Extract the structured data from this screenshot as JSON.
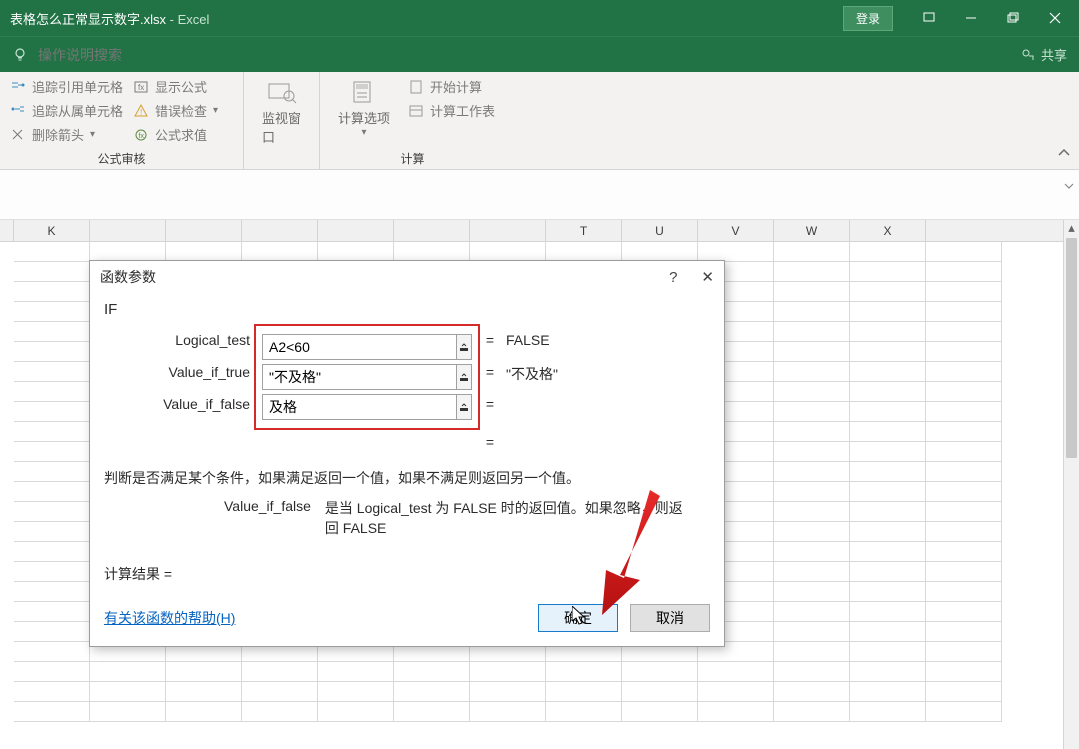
{
  "titlebar": {
    "filename": "表格怎么正常显示数字.xlsx",
    "separator": " - ",
    "app": "Excel",
    "login": "登录"
  },
  "searchbar": {
    "placeholder": "操作说明搜索",
    "share": "共享"
  },
  "ribbon": {
    "group1": {
      "trace_precedents": "追踪引用单元格",
      "trace_dependents": "追踪从属单元格",
      "remove_arrows": "删除箭头",
      "show_formulas": "显示公式",
      "error_checking": "错误检查",
      "evaluate_formula": "公式求值",
      "label": "公式审核"
    },
    "watch_window": "监视窗口",
    "calc_options": "计算选项",
    "group_calc": {
      "calc_now": "开始计算",
      "calc_sheet": "计算工作表",
      "label": "计算"
    }
  },
  "columns": [
    "K",
    "",
    "",
    "",
    "",
    "",
    "",
    "T",
    "U",
    "V",
    "W",
    "X"
  ],
  "dialog": {
    "title": "函数参数",
    "help": "?",
    "close": "✕",
    "func_name": "IF",
    "params": {
      "logical_test": {
        "label": "Logical_test",
        "value": "A2<60",
        "result": "FALSE"
      },
      "value_if_true": {
        "label": "Value_if_true",
        "value": "\"不及格\"",
        "result": "\"不及格\""
      },
      "value_if_false": {
        "label": "Value_if_false",
        "value": "及格",
        "result": ""
      }
    },
    "eq": "=",
    "desc": "判断是否满足某个条件，如果满足返回一个值，如果不满足则返回另一个值。",
    "arg_detail_name": "Value_if_false",
    "arg_detail_text": "是当 Logical_test 为 FALSE 时的返回值。如果忽略，则返回 FALSE",
    "result_label": "计算结果 =",
    "result_value": "",
    "help_link": "有关该函数的帮助(H)",
    "ok": "确定",
    "cancel": "取消"
  }
}
